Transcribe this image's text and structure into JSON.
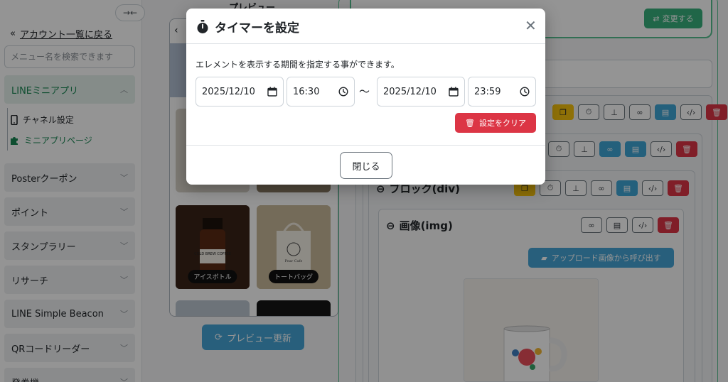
{
  "sidebar": {
    "collapse_icon": "→←",
    "back_link": "アカウント一覧に戻る",
    "search_placeholder": "メニュー名を検索できます",
    "groups": [
      {
        "label": "LINEミニアプリ",
        "expanded": true
      },
      {
        "label": "Posterクーポン"
      },
      {
        "label": "ポイント"
      },
      {
        "label": "スタンプラリー"
      },
      {
        "label": "リサーチ"
      },
      {
        "label": "LINE Simple Beacon"
      },
      {
        "label": "QRコードリーダー"
      },
      {
        "label": "発券機"
      }
    ],
    "sub_items": [
      {
        "label": "チャネル設定",
        "icon": "mobile-icon"
      },
      {
        "label": "ミニアプリページ",
        "icon": "puzzle-icon",
        "active": true
      }
    ]
  },
  "preview": {
    "heading": "プレビュー",
    "products": [
      {
        "label": "アイスボトル",
        "print": "COLD BREW COFFEE"
      },
      {
        "label": "トートバッグ",
        "print": "Pear Cafe"
      }
    ],
    "refresh_label": "プレビュー更新"
  },
  "editor": {
    "change_label": "変更する",
    "blocks": [
      {
        "title": "ブロック(div)"
      },
      {
        "title": "画像(img)"
      }
    ],
    "upload_label": "アップロード画像から呼び出す"
  },
  "modal": {
    "title": "タイマーを設定",
    "description": "エレメントを表示する期間を指定する事ができます。",
    "start_date": "2025/12/10",
    "start_time": "16:30",
    "separator": "〜",
    "end_date": "2025/12/10",
    "end_time": "23:59",
    "clear_label": "設定をクリア",
    "close_label": "閉じる"
  },
  "colors": {
    "accent_green": "#198754",
    "info_blue": "#45a4d6",
    "danger_red": "#dc3545",
    "warning_yellow": "#f4c20d"
  }
}
